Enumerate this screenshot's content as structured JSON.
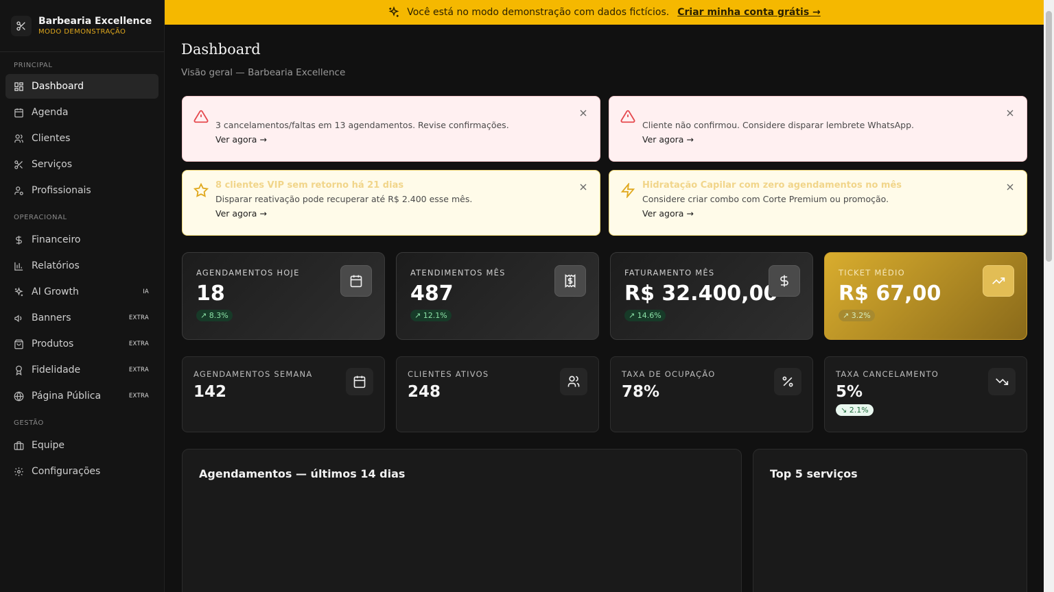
{
  "brand": {
    "name": "Barbearia Excellence",
    "subtitle": "MODO DEMONSTRAÇÃO"
  },
  "sidebar": {
    "sections": [
      "PRINCIPAL",
      "OPERACIONAL",
      "GESTÃO"
    ],
    "items": [
      {
        "label": "Dashboard",
        "icon": "dashboard-icon",
        "active": true
      },
      {
        "label": "Agenda",
        "icon": "calendar-icon"
      },
      {
        "label": "Clientes",
        "icon": "users-icon"
      },
      {
        "label": "Serviços",
        "icon": "scissors-icon"
      },
      {
        "label": "Profissionais",
        "icon": "user-cog-icon"
      },
      {
        "label": "Financeiro",
        "icon": "dollar-icon"
      },
      {
        "label": "Relatórios",
        "icon": "bar-chart-icon"
      },
      {
        "label": "AI Growth",
        "icon": "sparkles-icon",
        "badge": "IA"
      },
      {
        "label": "Banners",
        "icon": "megaphone-icon",
        "badge": "EXTRA"
      },
      {
        "label": "Produtos",
        "icon": "shopping-bag-icon",
        "badge": "EXTRA"
      },
      {
        "label": "Fidelidade",
        "icon": "award-icon",
        "badge": "EXTRA"
      },
      {
        "label": "Página Pública",
        "icon": "globe-icon",
        "badge": "EXTRA"
      },
      {
        "label": "Equipe",
        "icon": "briefcase-icon"
      },
      {
        "label": "Configurações",
        "icon": "gear-icon"
      }
    ]
  },
  "banner": {
    "text": "Você está no modo demonstração com dados fictícios.",
    "link": "Criar minha conta grátis →",
    "color": "#f5b800"
  },
  "header": {
    "title": "Dashboard",
    "subtitle": "Visão geral — Barbearia Excellence"
  },
  "alerts": [
    {
      "type": "danger",
      "title": "",
      "message": "3 cancelamentos/faltas em 13 agendamentos. Revise confirmações.",
      "link": "Ver agora →"
    },
    {
      "type": "danger",
      "title": "",
      "message": "Cliente não confirmou. Considere disparar lembrete WhatsApp.",
      "link": "Ver agora →"
    },
    {
      "type": "warning",
      "title": "8 clientes VIP sem retorno há 21 dias",
      "message": "Disparar reativação pode recuperar até R$ 2.400 esse mês.",
      "link": "Ver agora →"
    },
    {
      "type": "warning",
      "title": "Hidratação Capilar com zero agendamentos no mês",
      "message": "Considere criar combo com Corte Premium ou promoção.",
      "link": "Ver agora →"
    }
  ],
  "kpis": [
    {
      "label": "AGENDAMENTOS HOJE",
      "value": "18",
      "change": "↗ 8.3%",
      "icon": "calendar-icon"
    },
    {
      "label": "ATENDIMENTOS MÊS",
      "value": "487",
      "change": "↗ 12.1%",
      "icon": "receipt-icon"
    },
    {
      "label": "FATURAMENTO MÊS",
      "value": "R$ 32.400,00",
      "change": "↗ 14.6%",
      "icon": "dollar-icon"
    },
    {
      "label": "TICKET MÉDIO",
      "value": "R$ 67,00",
      "change": "↗ 3.2%",
      "icon": "trending-up-icon"
    }
  ],
  "kpis2": [
    {
      "label": "AGENDAMENTOS SEMANA",
      "value": "142",
      "change": "",
      "icon": "calendar-icon"
    },
    {
      "label": "CLIENTES ATIVOS",
      "value": "248",
      "change": "",
      "icon": "users-icon"
    },
    {
      "label": "TAXA DE OCUPAÇÃO",
      "value": "78%",
      "change": "",
      "icon": "percent-icon"
    },
    {
      "label": "TAXA CANCELAMENTO",
      "value": "5%",
      "change": "↘ 2.1%",
      "icon": "trending-down-icon"
    }
  ],
  "panels": {
    "left_title": "Agendamentos — últimos 14 dias",
    "right_title": "Top 5 serviços"
  }
}
